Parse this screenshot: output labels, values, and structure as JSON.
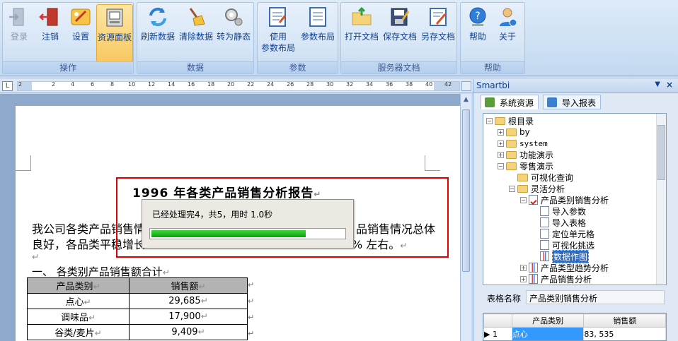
{
  "ribbon": {
    "groups": [
      {
        "label": "操作",
        "buttons": [
          {
            "label": "登录",
            "icon": "login-icon",
            "state": "disabled"
          },
          {
            "label": "注销",
            "icon": "logout-icon",
            "state": "normal"
          },
          {
            "label": "设置",
            "icon": "settings-icon",
            "state": "normal"
          },
          {
            "label": "资源面板",
            "icon": "resource-panel-icon",
            "state": "active"
          }
        ]
      },
      {
        "label": "数据",
        "buttons": [
          {
            "label": "刷新数据",
            "icon": "refresh-icon"
          },
          {
            "label": "清除数据",
            "icon": "broom-icon"
          },
          {
            "label": "转为静态",
            "icon": "convert-static-icon"
          }
        ]
      },
      {
        "label": "参数",
        "buttons": [
          {
            "label": "使用",
            "label2": "参数布局",
            "icon": "use-param-layout-icon"
          },
          {
            "label": "参数布局",
            "icon": "param-layout-icon"
          }
        ]
      },
      {
        "label": "服务器文档",
        "buttons": [
          {
            "label": "打开文档",
            "icon": "open-folder-icon"
          },
          {
            "label": "保存文档",
            "icon": "save-icon"
          },
          {
            "label": "另存文档",
            "icon": "save-as-icon"
          }
        ]
      },
      {
        "label": "帮助",
        "buttons": [
          {
            "label": "帮助",
            "icon": "help-icon"
          },
          {
            "label": "关于",
            "icon": "about-icon"
          }
        ]
      }
    ]
  },
  "ruler": {
    "corner": "L",
    "ticks": [
      "2",
      "2",
      "4",
      "6",
      "8",
      "10",
      "12",
      "14",
      "16",
      "18",
      "20",
      "22",
      "24",
      "26",
      "28",
      "30",
      "32",
      "34",
      "36",
      "38",
      "40",
      "42"
    ]
  },
  "document": {
    "title": "1996  年各类产品销售分析报告",
    "body_line1": "我公司各类产品销售情",
    "body_line1_tail": "品销售情况总体",
    "body_line2": "良好，各品类平稳增长",
    "body_line2_tail": "%  左右。",
    "section_heading": "一、    各类别产品销售额合计",
    "para_mark": "↵",
    "table": {
      "headers": [
        "产品类别",
        "销售额"
      ],
      "rows": [
        [
          "点心",
          "29,685"
        ],
        [
          "调味品",
          "17,900"
        ],
        [
          "谷类/麦片",
          "9,409"
        ]
      ]
    }
  },
  "progress": {
    "message": "已经处理完4，共5，用时 1.0秒",
    "processed": 4,
    "total": 5,
    "fraction": 0.8,
    "bar_color": "#0aa50a"
  },
  "highlight_color": "#e00000",
  "side_panel": {
    "title": "Smartbi",
    "pin": "▼",
    "close": "×",
    "tabs": [
      {
        "label": "系统资源",
        "icon": "system-resources-icon",
        "active": true
      },
      {
        "label": "导入报表",
        "icon": "import-report-icon",
        "active": false
      }
    ],
    "tree": [
      {
        "label": "根目录",
        "level": 0,
        "type": "folder",
        "expander": "−"
      },
      {
        "label": "by",
        "level": 1,
        "type": "folder",
        "expander": "+"
      },
      {
        "label": "system",
        "level": 1,
        "type": "folder",
        "expander": "+",
        "mono": true
      },
      {
        "label": "功能演示",
        "level": 1,
        "type": "folder",
        "expander": "+"
      },
      {
        "label": "零售演示",
        "level": 1,
        "type": "folder",
        "expander": "−"
      },
      {
        "label": "可视化查询",
        "level": 2,
        "type": "folder",
        "expander": ""
      },
      {
        "label": "灵活分析",
        "level": 2,
        "type": "folder",
        "expander": "−"
      },
      {
        "label": "产品类别销售分析",
        "level": 3,
        "type": "report-check",
        "expander": "−"
      },
      {
        "label": "导入参数",
        "level": 4,
        "type": "doc",
        "expander": ""
      },
      {
        "label": "导入表格",
        "level": 4,
        "type": "doc",
        "expander": ""
      },
      {
        "label": "定位单元格",
        "level": 4,
        "type": "doc",
        "expander": ""
      },
      {
        "label": "可视化挑选",
        "level": 4,
        "type": "doc",
        "expander": ""
      },
      {
        "label": "数据作图",
        "level": 4,
        "type": "chart",
        "expander": "",
        "selected": true
      },
      {
        "label": "产品类型趋势分析",
        "level": 3,
        "type": "chart",
        "expander": "+"
      },
      {
        "label": "产品销售分析",
        "level": 3,
        "type": "chart",
        "expander": "+"
      }
    ],
    "name_label": "表格名称",
    "name_value": "产品类别销售分析",
    "grid": {
      "headers": [
        "",
        "产品类别",
        "销售额"
      ],
      "row": {
        "marker": "▶",
        "index": "1",
        "category": "点心",
        "value": "83, 535"
      }
    }
  }
}
